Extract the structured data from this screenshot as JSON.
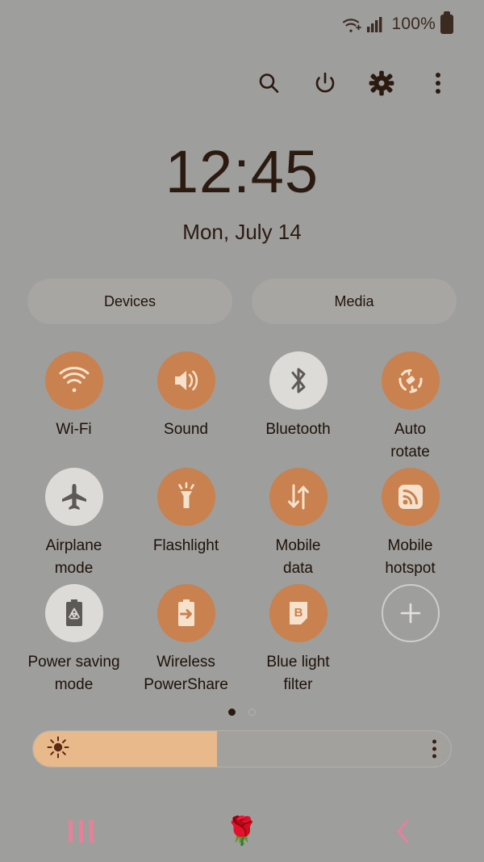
{
  "status_bar": {
    "wifi_icon": "wifi-plus-icon",
    "signal_icon": "cellular-signal-icon",
    "battery_text": "100%",
    "battery_icon": "battery-full-icon"
  },
  "toolbar": {
    "buttons": [
      {
        "name": "search-icon",
        "label": "Search"
      },
      {
        "name": "power-icon",
        "label": "Power"
      },
      {
        "name": "settings-gear-icon",
        "label": "Settings"
      },
      {
        "name": "overflow-menu-icon",
        "label": "More options"
      }
    ]
  },
  "clock": {
    "time": "12:45",
    "date": "Mon, July 14"
  },
  "pills": [
    {
      "label": "Devices"
    },
    {
      "label": "Media"
    }
  ],
  "tiles": [
    {
      "label": "Wi-Fi",
      "icon": "wifi-icon",
      "state": "on"
    },
    {
      "label": "Sound",
      "icon": "speaker-icon",
      "state": "on"
    },
    {
      "label": "Bluetooth",
      "icon": "bluetooth-icon",
      "state": "off"
    },
    {
      "label": "Auto\nrotate",
      "icon": "auto-rotate-icon",
      "state": "on"
    },
    {
      "label": "Airplane\nmode",
      "icon": "airplane-icon",
      "state": "off"
    },
    {
      "label": "Flashlight",
      "icon": "flashlight-icon",
      "state": "on"
    },
    {
      "label": "Mobile\ndata",
      "icon": "mobile-data-icon",
      "state": "on"
    },
    {
      "label": "Mobile\nhotspot",
      "icon": "hotspot-icon",
      "state": "on"
    },
    {
      "label": "Power saving\nmode",
      "icon": "power-saving-icon",
      "state": "off"
    },
    {
      "label": "Wireless\nPowerShare",
      "icon": "powershare-icon",
      "state": "on"
    },
    {
      "label": "Blue light\nfilter",
      "icon": "blue-light-icon",
      "state": "on"
    },
    {
      "label": "",
      "icon": "add-tile-icon",
      "state": "add"
    }
  ],
  "page_dots": {
    "total": 2,
    "active_index": 0
  },
  "brightness": {
    "icon": "brightness-sun-icon",
    "fill_percent": 44,
    "menu_icon": "overflow-menu-icon"
  },
  "navigation_bar": {
    "recents": {
      "name": "recents-icon",
      "label": "Recents"
    },
    "home": {
      "name": "home-rose-icon",
      "glyph": "🌹",
      "label": "Home"
    },
    "back": {
      "name": "back-chevron-icon",
      "label": "Back"
    }
  },
  "colors": {
    "background": "#9e9e9c",
    "accent_on": "#c8814f",
    "tile_off": "#dddbd8",
    "icon_light": "#f6e2cc",
    "icon_dark": "#5d5955",
    "text": "#2a1a12",
    "slider_fill": "#e8b98a",
    "nav_pink": "#e8809a"
  }
}
